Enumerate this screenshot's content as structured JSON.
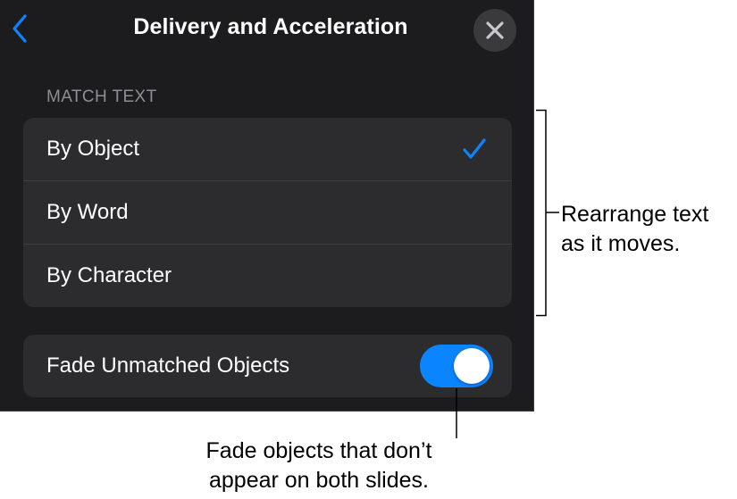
{
  "header": {
    "title": "Delivery and Acceleration",
    "back_icon": "chevron-left-icon",
    "close_icon": "close-icon"
  },
  "match_text": {
    "section_label": "MATCH TEXT",
    "options": [
      {
        "label": "By Object",
        "selected": true
      },
      {
        "label": "By Word",
        "selected": false
      },
      {
        "label": "By Character",
        "selected": false
      }
    ],
    "selected_icon": "checkmark-icon"
  },
  "fade_unmatched": {
    "label": "Fade Unmatched Objects",
    "enabled": true
  },
  "callouts": {
    "match_text_line1": "Rearrange text",
    "match_text_line2": "as it moves.",
    "fade_line1": "Fade objects that don’t",
    "fade_line2": "appear on both slides."
  },
  "colors": {
    "panel_bg": "#1c1c1e",
    "group_bg": "#2c2c2e",
    "accent": "#0a84ff",
    "secondary_text": "#8e8e93"
  }
}
